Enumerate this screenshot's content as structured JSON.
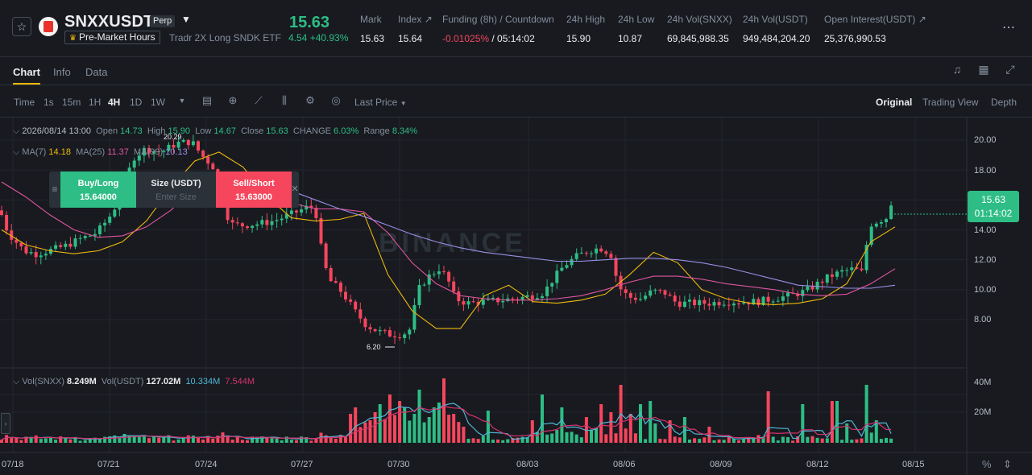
{
  "header": {
    "favorite_icon": "star-icon",
    "symbol": "SNXXUSDT",
    "badge": "Perp",
    "premarket": "Pre-Market Hours",
    "subtitle": "Tradr 2X Long SNDK ETF",
    "last_price": "15.63",
    "change": "4.54 +40.93%",
    "stats": [
      {
        "label": "Mark",
        "value": "15.63"
      },
      {
        "label": "Index ↗",
        "value": "15.64"
      },
      {
        "label": "Funding (8h) / Countdown",
        "value_neg": "-0.01025%",
        "value_rest": " / 05:14:02"
      },
      {
        "label": "24h High",
        "value": "15.90"
      },
      {
        "label": "24h Low",
        "value": "10.87"
      },
      {
        "label": "24h Vol(SNXX)",
        "value": "69,845,988.35"
      },
      {
        "label": "24h Vol(USDT)",
        "value": "949,484,204.20"
      },
      {
        "label": "Open Interest(USDT) ↗",
        "value": "25,376,990.53"
      }
    ],
    "more_icon": "more-dots-icon"
  },
  "tabs": [
    "Chart",
    "Info",
    "Data"
  ],
  "toolbar": {
    "time_label": "Time",
    "intervals": [
      "1s",
      "15m",
      "1H",
      "4H",
      "1D",
      "1W"
    ],
    "active_interval": "4H",
    "price_type": "Last Price",
    "views": [
      "Original",
      "Trading View",
      "Depth"
    ],
    "active_view": "Original"
  },
  "ohlc": {
    "date": "2026/08/14 13:00",
    "open_label": "Open",
    "open": "14.73",
    "high_label": "High",
    "high": "15.90",
    "low_label": "Low",
    "low": "14.67",
    "close_label": "Close",
    "close": "15.63",
    "change_label": "CHANGE",
    "change": "6.03%",
    "range_label": "Range",
    "range": "8.34%"
  },
  "ma": {
    "ma7_label": "MA(7)",
    "ma7": "14.18",
    "ma25_label": "MA(25)",
    "ma25": "11.37",
    "ma99_label": "MA(99)",
    "ma99": "10.13"
  },
  "volume": {
    "snxx_label": "Vol(SNXX)",
    "snxx": "8.249M",
    "usdt_label": "Vol(USDT)",
    "usdt": "127.02M",
    "ma1": "10.334M",
    "ma2": "7.544M"
  },
  "order_widget": {
    "buy_label": "Buy/Long",
    "buy_price": "15.64000",
    "size_label": "Size (USDT)",
    "size_placeholder": "Enter Size",
    "sell_label": "Sell/Short",
    "sell_price": "15.63000"
  },
  "price_tag": {
    "price": "15.63",
    "countdown": "01:14:02"
  },
  "annotations": {
    "high": "20.29",
    "low": "6.20"
  },
  "watermark": "BINANCE",
  "colors": {
    "up": "#2ebd85",
    "down": "#f6465d",
    "ma7": "#f0b90b",
    "ma25": "#e0559f",
    "ma99": "#9b8fe6",
    "vol_ma1": "#4fb8d8",
    "vol_ma2": "#d6336c"
  },
  "chart_data": {
    "type": "candlestick",
    "y_ticks": [
      "20.00",
      "18.00",
      "14.00",
      "12.00",
      "10.00",
      "8.00"
    ],
    "ylim": [
      6,
      21
    ],
    "x_ticks": [
      "07/18",
      "07/21",
      "07/24",
      "07/27",
      "07/30",
      "08/03",
      "08/06",
      "08/09",
      "08/12",
      "08/15"
    ],
    "volume_ticks": [
      "40M",
      "20M"
    ],
    "volume_ylim": [
      0,
      45
    ],
    "series": [
      {
        "name": "MA(7)",
        "values": [
          14.0,
          13.0,
          12.6,
          12.4,
          12.6,
          13.2,
          14.6,
          16.8,
          18.6,
          19.2,
          18.2,
          16.2,
          14.8,
          14.6,
          14.7,
          15.1,
          11.0,
          8.6,
          7.4,
          7.4,
          9.6,
          10.3,
          9.2,
          9.1,
          9.3,
          9.7,
          11.0,
          12.5,
          11.8,
          10.0,
          9.4,
          9.1,
          9.0,
          9.1,
          9.4,
          10.4,
          13.2,
          14.2
        ]
      },
      {
        "name": "MA(25)",
        "values": [
          17.2,
          16.2,
          15.0,
          14.0,
          13.5,
          13.6,
          14.2,
          15.3,
          16.8,
          17.8,
          17.6,
          16.8,
          15.8,
          15.4,
          15.4,
          15.2,
          13.8,
          11.8,
          10.4,
          9.6,
          9.4,
          9.3,
          9.3,
          9.4,
          9.6,
          10.0,
          10.5,
          10.9,
          10.9,
          10.7,
          10.4,
          10.2,
          10.0,
          9.7,
          9.6,
          9.7,
          10.4,
          11.4
        ]
      },
      {
        "name": "MA(99)",
        "values": [
          null,
          null,
          null,
          null,
          null,
          null,
          null,
          null,
          null,
          null,
          null,
          17.4,
          16.6,
          16.0,
          15.4,
          14.9,
          14.3,
          13.7,
          13.2,
          12.8,
          12.5,
          12.3,
          12.1,
          11.9,
          11.9,
          12.0,
          12.1,
          12.1,
          12.0,
          11.8,
          11.5,
          11.1,
          10.7,
          10.3,
          10.2,
          10.1,
          10.1,
          10.3
        ]
      }
    ]
  }
}
